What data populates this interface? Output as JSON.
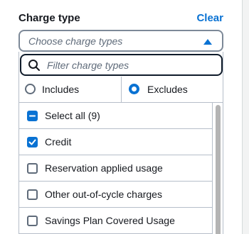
{
  "filter_panel": {
    "title": "Charge type",
    "clear_label": "Clear",
    "select_placeholder": "Choose charge types",
    "search_placeholder": "Filter charge types",
    "mode": {
      "includes_label": "Includes",
      "excludes_label": "Excludes",
      "selected": "Excludes"
    },
    "items": [
      {
        "label": "Select all (9)",
        "state": "indeterminate"
      },
      {
        "label": "Credit",
        "state": "checked"
      },
      {
        "label": "Reservation applied usage",
        "state": "unchecked"
      },
      {
        "label": "Other out-of-cycle charges",
        "state": "unchecked"
      },
      {
        "label": "Savings Plan Covered Usage",
        "state": "unchecked"
      }
    ]
  },
  "icons": {
    "search": "search-icon",
    "caret": "caret-up-icon",
    "check": "checkmark-icon",
    "minus": "minus-icon"
  },
  "colors": {
    "accent": "#0972d3",
    "text": "#16191f",
    "placeholder": "#5f6b7a",
    "border": "#b6bec9"
  }
}
